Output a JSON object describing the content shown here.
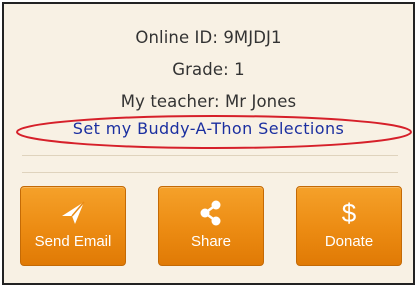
{
  "profile": {
    "online_id": "Online ID: 9MJDJ1",
    "grade": "Grade: 1",
    "teacher": "My teacher: Mr Jones"
  },
  "buddy_link": {
    "label": "Set my Buddy-A-Thon Selections"
  },
  "actions": {
    "email": {
      "label": "Send Email",
      "icon": "paper-plane-icon"
    },
    "share": {
      "label": "Share",
      "icon": "share-icon"
    },
    "donate": {
      "label": "Donate",
      "icon": "dollar-icon",
      "glyph": "$"
    }
  },
  "colors": {
    "panel_background": "#f8f1e4",
    "button_orange": "#ec8b12",
    "link_blue": "#1b2fa0",
    "highlight_red": "#d6202a"
  }
}
